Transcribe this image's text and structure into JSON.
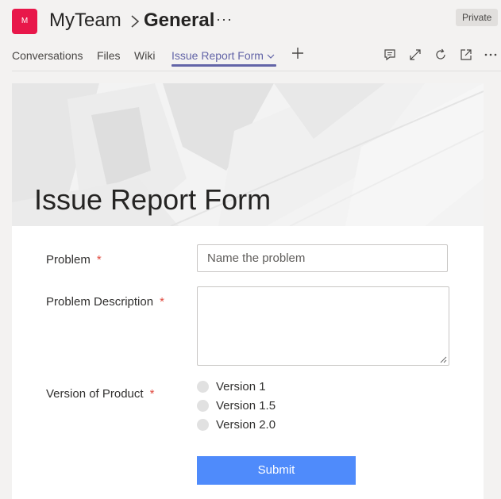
{
  "header": {
    "team_avatar_letter": "M",
    "team_name": "MyTeam",
    "channel_name": "General",
    "more": "···",
    "privacy_badge": "Private"
  },
  "tabs": [
    {
      "label": "Conversations",
      "active": false
    },
    {
      "label": "Files",
      "active": false
    },
    {
      "label": "Wiki",
      "active": false
    },
    {
      "label": "Issue Report Form",
      "active": true
    }
  ],
  "toolbar_icons": [
    "conversation-icon",
    "expand-icon",
    "reload-icon",
    "popout-icon",
    "more-options-icon"
  ],
  "form": {
    "title": "Issue Report Form",
    "fields": {
      "problem": {
        "label": "Problem",
        "required_mark": "*",
        "placeholder": "Name the problem"
      },
      "description": {
        "label": "Problem Description",
        "required_mark": "*",
        "value": ""
      },
      "version": {
        "label": "Version of Product",
        "required_mark": "*",
        "options": [
          "Version 1",
          "Version 1.5",
          "Version 2.0"
        ],
        "selected": null
      }
    },
    "submit_label": "Submit"
  },
  "colors": {
    "accent": "#6264a7",
    "avatar": "#e8174a",
    "submit": "#4f8bfb",
    "required": "#e04a3f"
  }
}
